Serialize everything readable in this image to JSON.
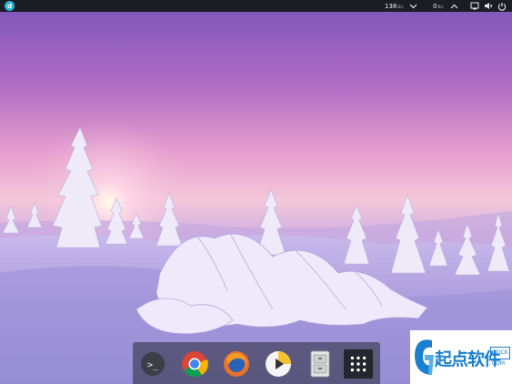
{
  "top_panel": {
    "launcher_icon": "deepin-logo-icon",
    "net_down": {
      "value": "138",
      "unit": "B/s"
    },
    "net_up": {
      "value": "0",
      "unit": "B/s"
    },
    "tray_icons": [
      "chevron-down-icon",
      "chevron-up-icon",
      "display-icon",
      "volume-icon",
      "power-icon"
    ]
  },
  "dock": {
    "items": [
      {
        "name": "terminal",
        "label": ">_"
      },
      {
        "name": "chrome"
      },
      {
        "name": "firefox"
      },
      {
        "name": "media-player"
      },
      {
        "name": "file-archive"
      },
      {
        "name": "app-launcher"
      }
    ]
  },
  "watermark": {
    "text": "起点软件",
    "box_text": "QDCK",
    "suffix": ".COM",
    "color": "#1a7fd0"
  },
  "colors": {
    "panel_bg": "#1c1d24",
    "accent": "#2bb5d8"
  }
}
